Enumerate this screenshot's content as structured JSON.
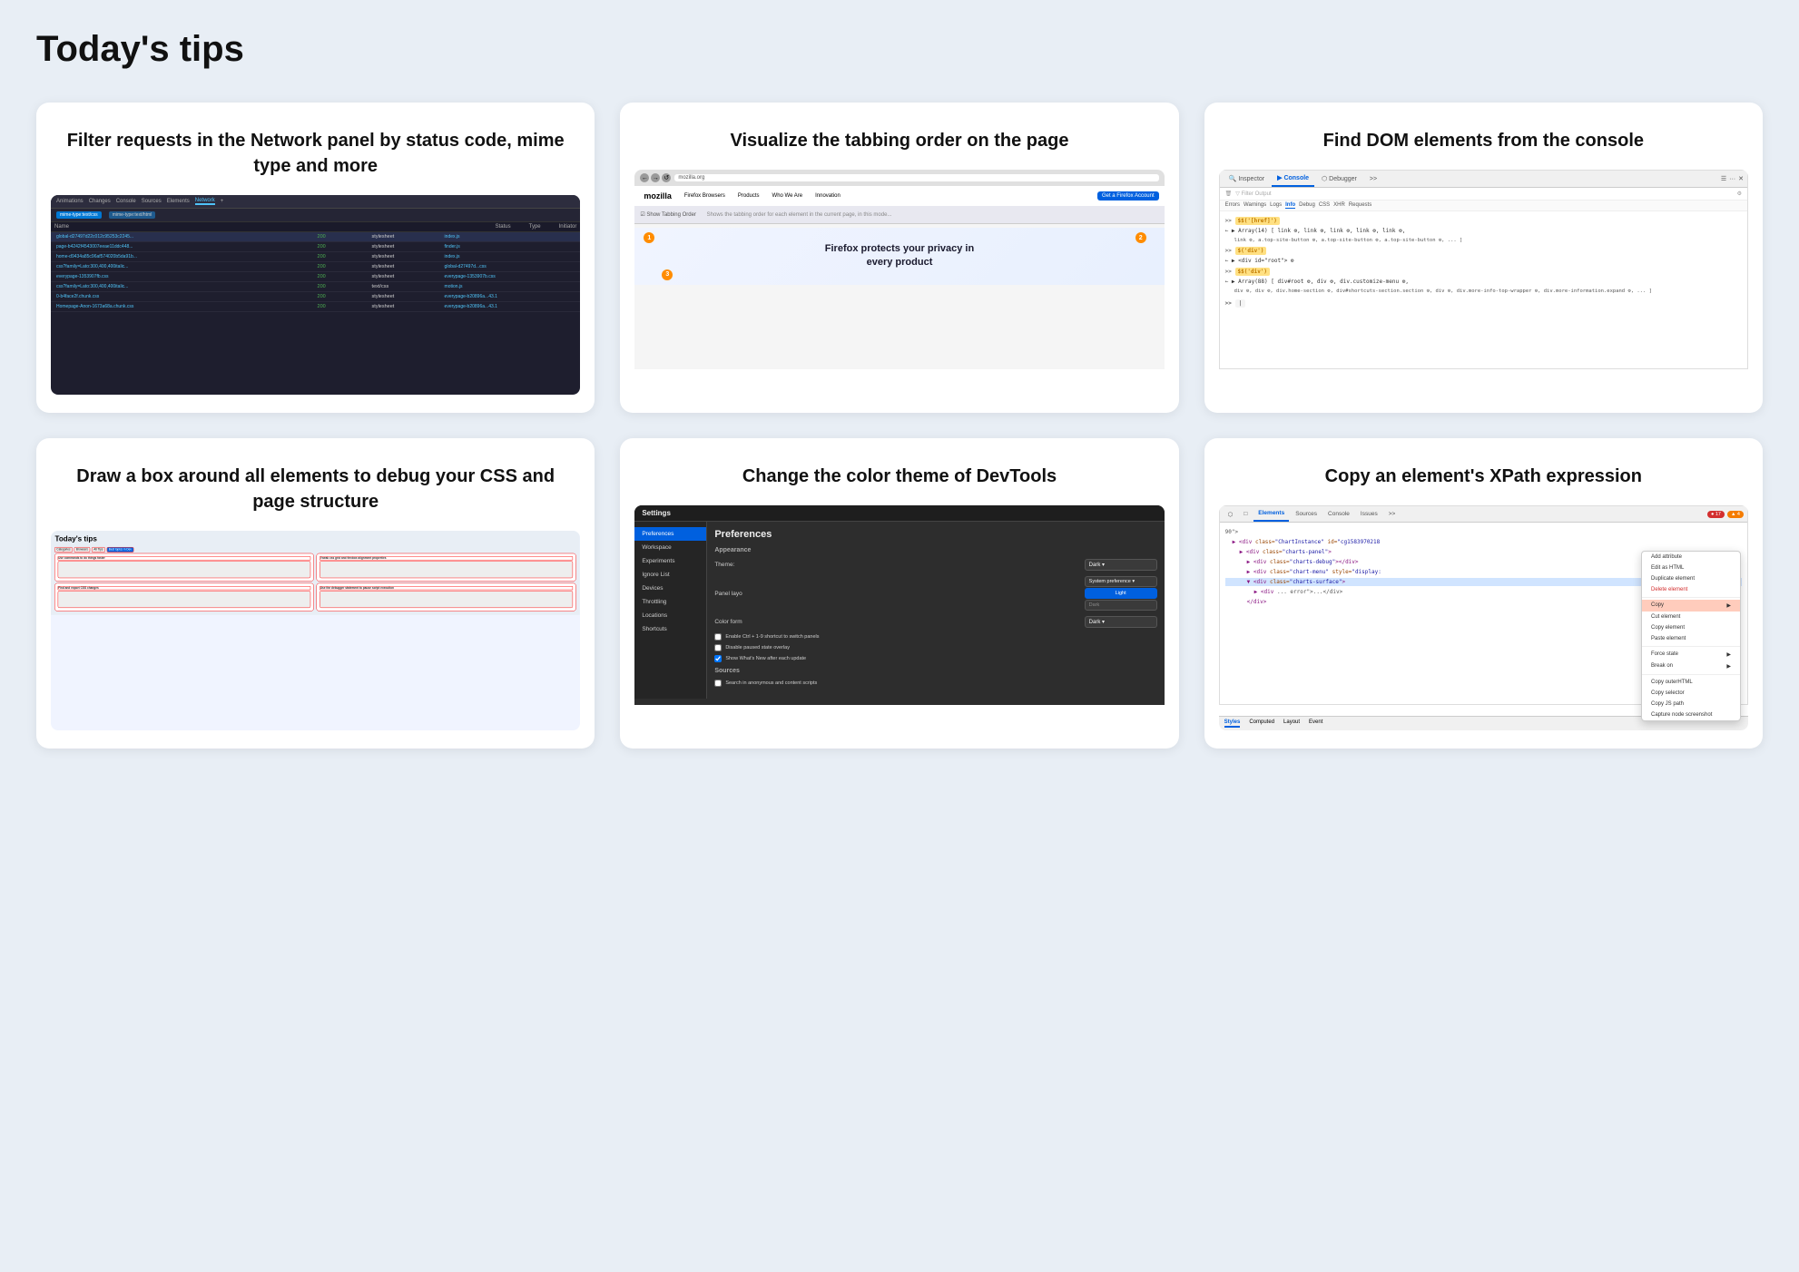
{
  "page": {
    "title": "Today's tips"
  },
  "cards": [
    {
      "id": "card-network",
      "title": "Filter requests in the Network panel by status code, mime type and more",
      "preview_type": "network"
    },
    {
      "id": "card-taborder",
      "title": "Visualize the tabbing order on the page",
      "preview_type": "taborder"
    },
    {
      "id": "card-console",
      "title": "Find DOM elements from the console",
      "preview_type": "console"
    },
    {
      "id": "card-drawbox",
      "title": "Draw a box around all elements to debug your CSS and page structure",
      "preview_type": "drawbox"
    },
    {
      "id": "card-settings",
      "title": "Change the color theme of DevTools",
      "preview_type": "settings"
    },
    {
      "id": "card-xpath",
      "title": "Copy an element's XPath expression",
      "preview_type": "xpath"
    }
  ],
  "network": {
    "tabs": [
      "Animations",
      "Changes",
      "Console",
      "Sources",
      "Elements",
      "Network",
      "+"
    ],
    "active_tab": "Network",
    "filter1": "mime-type:text/css",
    "filter2": "mime-type:text/html",
    "headers": [
      "Name",
      "Status",
      "Type",
      "Initiator"
    ],
    "rows": [
      {
        "name": "global-d27497d22c012c95253c22459f6c448b1c12...",
        "status": "200",
        "type": "stylesheet",
        "initiator": "index.js"
      },
      {
        "name": "page-b4242f4543007eeae11ddc448b4b1d5efa...",
        "status": "200",
        "type": "stylesheet",
        "initiator": "finder.js"
      },
      {
        "name": "home-d9434a85c96af574020b5da91b3b0ee6da...",
        "status": "200",
        "type": "stylesheet",
        "initiator": "index.js"
      },
      {
        "name": "css?family=Lato:300,400,400italic,700,700italic,90...",
        "status": "200",
        "type": "stylesheet",
        "initiator": "global-d27497d...css"
      },
      {
        "name": "everypage-1353907fb.css",
        "status": "200",
        "type": "stylesheet",
        "initiator": "everypage-1353907b.css"
      },
      {
        "name": "css?family=Lato:300,400,400italic,700,700italic,90...",
        "status": "200",
        "type": "text/css",
        "initiator": "motion.js"
      },
      {
        "name": "0-b4face2f.chunk.css",
        "status": "200",
        "type": "stylesheet",
        "initiator": "everypage-b20896a...43.1"
      },
      {
        "name": "Homepage-Anon-1673a68a.chunk.css",
        "status": "200",
        "type": "stylesheet",
        "initiator": "everypage-b20896a...43.1"
      }
    ]
  },
  "console": {
    "tabs": [
      "Inspector",
      "Console",
      "Debugger",
      ">>"
    ],
    "active_tab": "Console",
    "filter_tabs": [
      "Errors",
      "Warnings",
      "Logs",
      "Info",
      "Debug",
      "CSS",
      "XHR",
      "Requests"
    ],
    "active_filter": "Info",
    "commands": [
      {
        "cmd": "$$('[href]')",
        "result": "Array(14) [ link, link, link, link, link, link, a.top-site-button, a.top-site-button, a.top-site-button, ... ]"
      },
      {
        "cmd": "$('div')",
        "result": "< div id=\"root\"> "
      },
      {
        "cmd": "$$('div')",
        "result": "Array(88) [ div#root, div, div.customize-menu, div, div, div.home-section, div#shortcuts-section.section, div, div.more-info-top-wrapper, div.more-information.expand, ... ]"
      }
    ]
  },
  "settings": {
    "title": "Settings",
    "section": "Preferences",
    "nav_items": [
      "Preferences",
      "Workspace",
      "Experiments",
      "Ignore List",
      "Devices",
      "Throttling",
      "Locations",
      "Shortcuts"
    ],
    "active_nav": "Preferences",
    "subsection": "Appearance",
    "rows": [
      {
        "label": "Theme:",
        "value": "Dark",
        "type": "select"
      },
      {
        "label": "Panel layc",
        "value": "System preference",
        "type": "select"
      },
      {
        "label": "",
        "value": "Light",
        "type": "select-active"
      },
      {
        "label": "Color form",
        "value": "Dark",
        "type": "select"
      }
    ],
    "checkboxes": [
      {
        "label": "Enable Ctrl + 1-9 shortcut to switch panels",
        "checked": false
      },
      {
        "label": "Disable paused state overlay",
        "checked": false
      },
      {
        "label": "Show What's New after each update",
        "checked": true
      }
    ],
    "sources_title": "Sources",
    "sources_checkboxes": [
      {
        "label": "Search in anonymous and content scripts",
        "checked": false
      }
    ]
  },
  "xpath": {
    "tabs": [
      "Elements",
      "Sources",
      "Console",
      "Issues",
      ">>"
    ],
    "active_tab": "Elements",
    "badges": {
      "red": "● 17",
      "orange": "▲ 4"
    },
    "code_lines": [
      "90\">",
      "▶ <div class=\"ChartInstance\" id=\"cg1583970218\">",
      "▶ <div class=\"charts-panel\">",
      "▶ <div class=\"charts-debug\"></div>",
      "▶ <div class=\"chart-menu\" style=\"display:",
      "▼ <div class=\"charts-surface\">",
      "  ▶ <div ... error\">...</div>",
      "  </div>",
      "  </div>"
    ],
    "context_menu": {
      "items": [
        {
          "label": "Add attribute"
        },
        {
          "label": "Edit as HTML"
        },
        {
          "label": "Duplicate element"
        },
        {
          "label": "Delete element"
        },
        {
          "label": "Copy",
          "has_submenu": true,
          "active": true
        },
        {
          "label": "Cut element"
        },
        {
          "label": "Copy element"
        },
        {
          "label": "Paste element"
        },
        {
          "label": "---"
        },
        {
          "label": "Force state",
          "has_submenu": true
        },
        {
          "label": "Break on",
          "has_submenu": true
        },
        {
          "label": "Copy outerHTML"
        },
        {
          "label": "Copy selector"
        },
        {
          "label": "Copy JS path"
        },
        {
          "label": "Capture node screenshot"
        }
      ]
    }
  }
}
